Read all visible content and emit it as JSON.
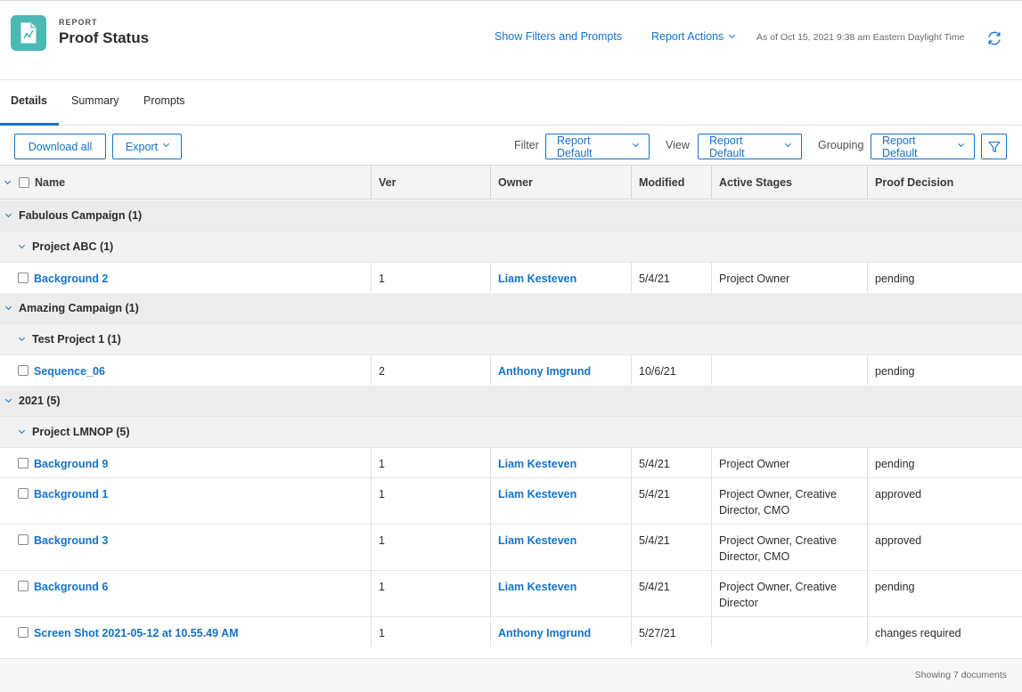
{
  "header": {
    "kicker": "REPORT",
    "title": "Proof Status",
    "show_filters": "Show Filters and Prompts",
    "report_actions": "Report Actions",
    "as_of": "As of Oct 15, 2021 9:38 am Eastern Daylight Time",
    "accent_color": "#1473c9",
    "icon_color": "#4bb8b3"
  },
  "tabs": [
    {
      "label": "Details",
      "active": true
    },
    {
      "label": "Summary",
      "active": false
    },
    {
      "label": "Prompts",
      "active": false
    }
  ],
  "toolbar": {
    "download_all": "Download all",
    "export": "Export",
    "filter_label": "Filter",
    "filter_value": "Report Default",
    "view_label": "View",
    "view_value": "Report Default",
    "grouping_label": "Grouping",
    "grouping_value": "Report Default"
  },
  "table": {
    "columns": [
      "Name",
      "Ver",
      "Owner",
      "Modified",
      "Active Stages",
      "Proof Decision"
    ],
    "groups": [
      {
        "label": "Fabulous Campaign (1)",
        "subgroups": [
          {
            "label": "Project ABC (1)",
            "rows": [
              {
                "name": "Background 2",
                "ver": "1",
                "owner": "Liam Kesteven",
                "modified": "5/4/21",
                "stages": "Project Owner",
                "decision": "pending"
              }
            ]
          }
        ]
      },
      {
        "label": "Amazing Campaign (1)",
        "subgroups": [
          {
            "label": "Test Project 1 (1)",
            "rows": [
              {
                "name": "Sequence_06",
                "ver": "2",
                "owner": "Anthony Imgrund",
                "modified": "10/6/21",
                "stages": "",
                "decision": "pending"
              }
            ]
          }
        ]
      },
      {
        "label": "2021 (5)",
        "subgroups": [
          {
            "label": "Project LMNOP (5)",
            "rows": [
              {
                "name": "Background 9",
                "ver": "1",
                "owner": "Liam Kesteven",
                "modified": "5/4/21",
                "stages": "Project Owner",
                "decision": "pending"
              },
              {
                "name": "Background 1",
                "ver": "1",
                "owner": "Liam Kesteven",
                "modified": "5/4/21",
                "stages": "Project Owner, Creative Director, CMO",
                "decision": "approved"
              },
              {
                "name": "Background 3",
                "ver": "1",
                "owner": "Liam Kesteven",
                "modified": "5/4/21",
                "stages": "Project Owner, Creative Director, CMO",
                "decision": "approved"
              },
              {
                "name": "Background 6",
                "ver": "1",
                "owner": "Liam Kesteven",
                "modified": "5/4/21",
                "stages": "Project Owner, Creative Director",
                "decision": "pending"
              },
              {
                "name": "Screen Shot 2021-05-12 at 10.55.49 AM",
                "ver": "1",
                "owner": "Anthony Imgrund",
                "modified": "5/27/21",
                "stages": "",
                "decision": "changes required"
              }
            ]
          }
        ]
      }
    ]
  },
  "footer": {
    "showing": "Showing 7 documents"
  }
}
